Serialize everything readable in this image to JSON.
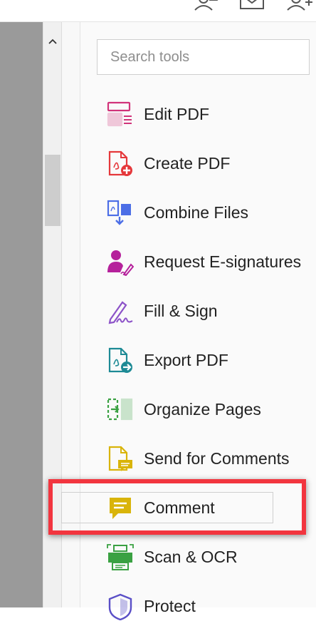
{
  "search": {
    "placeholder": "Search tools"
  },
  "top_icons": [
    "share-user-icon",
    "mail-icon",
    "add-user-icon"
  ],
  "tools": [
    {
      "label": "Edit PDF",
      "icon": "edit-pdf-icon",
      "color": "#d1347a"
    },
    {
      "label": "Create PDF",
      "icon": "create-pdf-icon",
      "color": "#e5383b"
    },
    {
      "label": "Combine Files",
      "icon": "combine-files-icon",
      "color": "#4c6ee6"
    },
    {
      "label": "Request E-signatures",
      "icon": "request-esignatures-icon",
      "color": "#b5219b"
    },
    {
      "label": "Fill & Sign",
      "icon": "fill-sign-icon",
      "color": "#8c52c8"
    },
    {
      "label": "Export PDF",
      "icon": "export-pdf-icon",
      "color": "#1d8a95"
    },
    {
      "label": "Organize Pages",
      "icon": "organize-pages-icon",
      "color": "#3aa142"
    },
    {
      "label": "Send for Comments",
      "icon": "send-for-comments-icon",
      "color": "#d9b40a"
    },
    {
      "label": "Comment",
      "icon": "comment-icon",
      "color": "#d9b40a",
      "highlighted": true
    },
    {
      "label": "Scan & OCR",
      "icon": "scan-ocr-icon",
      "color": "#3aa142"
    },
    {
      "label": "Protect",
      "icon": "protect-icon",
      "color": "#5a4fc7"
    }
  ],
  "highlight_color": "#f2353f"
}
